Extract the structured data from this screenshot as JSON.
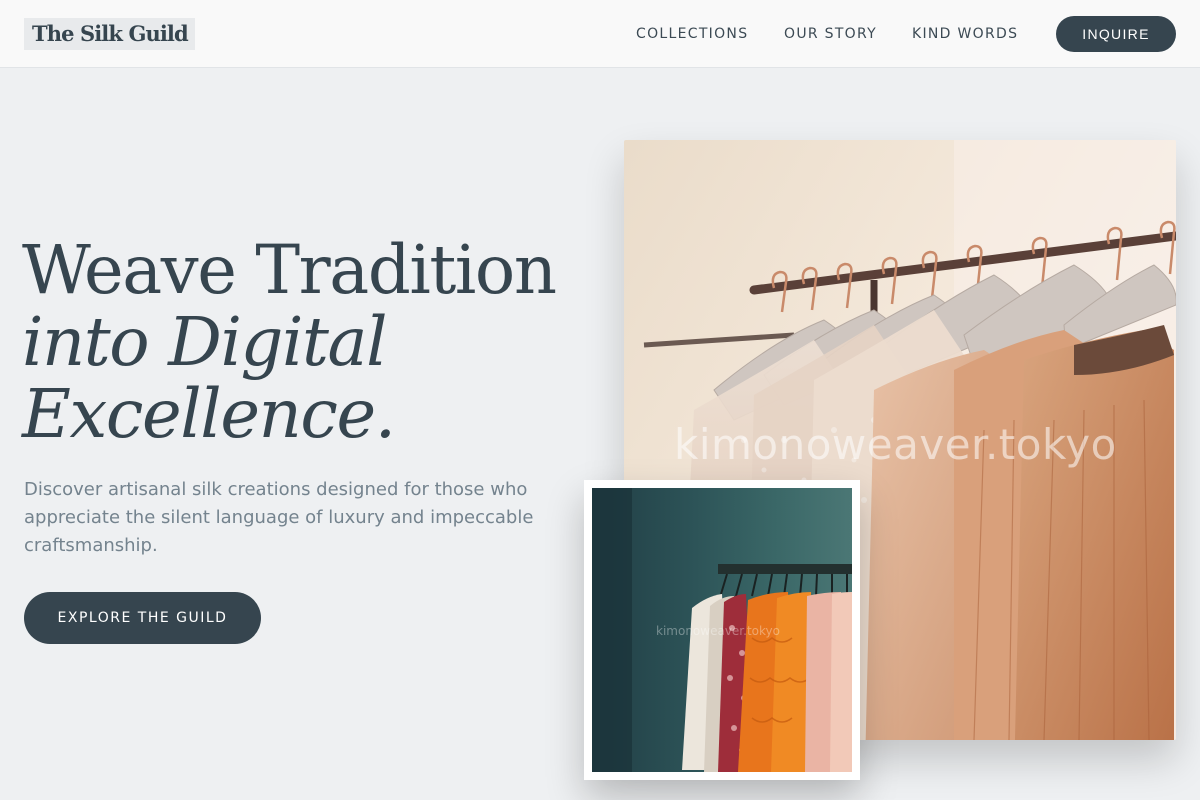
{
  "brand": {
    "name": "The Silk Guild"
  },
  "nav": {
    "items": [
      {
        "label": "COLLECTIONS"
      },
      {
        "label": "OUR STORY"
      },
      {
        "label": "KIND WORDS"
      }
    ],
    "cta_label": "INQUIRE"
  },
  "hero": {
    "title_line1": "Weave Tradition",
    "title_line2": "into Digital",
    "title_line3": "Excellence.",
    "subtitle": "Discover artisanal silk creations designed for those who appreciate the silent language of luxury and impeccable craftsmanship.",
    "cta_label": "EXPLORE THE GUILD"
  },
  "images": {
    "main_watermark": "kimonoweaver.tokyo",
    "inset_watermark": "kimonoweaver.tokyo"
  },
  "colors": {
    "accent": "#36454f",
    "background": "#eef0f2",
    "header_bg": "#f9f9f9",
    "subtitle": "#74838e"
  }
}
